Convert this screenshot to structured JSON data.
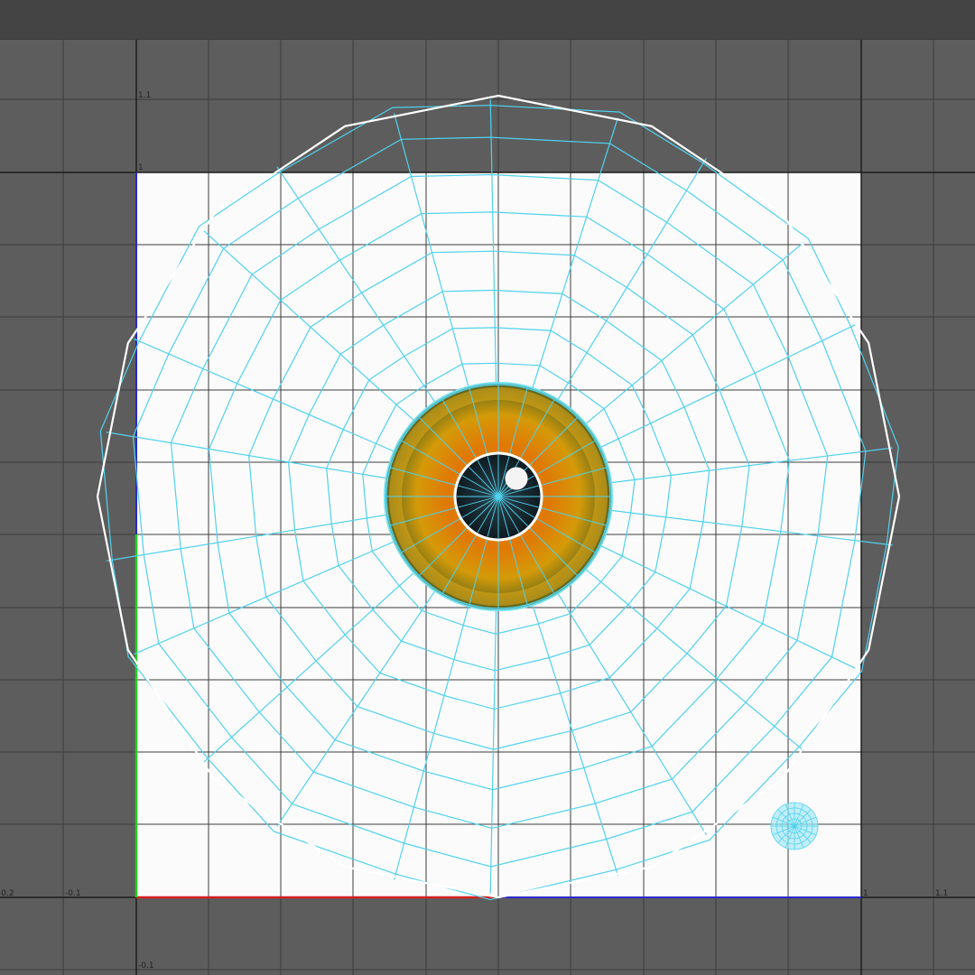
{
  "window": {
    "title": ""
  },
  "uv_editor": {
    "grid_labels": {
      "v_1_1": "1.1",
      "v_1": "1",
      "u_neg_0_2": "-0.2",
      "u_neg_0_1": "-0.1",
      "u_1": "1",
      "u_1_1": "1.1",
      "v_neg_0_1": "-0.1"
    },
    "colors": {
      "viewport_bg": "#5d5d5d",
      "uv_tile": "#fcfbfb",
      "grid_line": "#3c3c3c",
      "wire": "#4fd2ee",
      "border_edge": "#ffffff",
      "u_axis": "#d62020",
      "v_axis": "#22d022",
      "tile_edge": "#2a2acc",
      "iris_outer": "#5a5a10",
      "iris_mid": "#e07b06",
      "pupil": "#14262e"
    }
  }
}
